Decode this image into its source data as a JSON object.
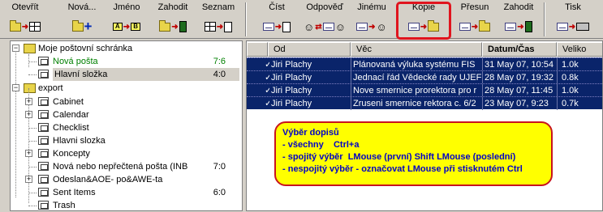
{
  "toolbar": {
    "buttons": [
      {
        "label": "Otevřít",
        "icon": "open-icon"
      },
      {
        "label": "Nová...",
        "icon": "new-folder-icon"
      },
      {
        "label": "Jméno",
        "icon": "rename-icon"
      },
      {
        "label": "Zahodit",
        "icon": "trash-icon"
      },
      {
        "label": "Seznam",
        "icon": "list-icon"
      },
      {
        "label": "Číst",
        "icon": "read-icon"
      },
      {
        "label": "Odpověď",
        "icon": "reply-icon"
      },
      {
        "label": "Jinému",
        "icon": "forward-icon"
      },
      {
        "label": "Kopie",
        "icon": "copy-icon"
      },
      {
        "label": "Přesun",
        "icon": "move-icon"
      },
      {
        "label": "Zahodit",
        "icon": "trash-icon"
      },
      {
        "label": "Tisk",
        "icon": "print-icon"
      }
    ],
    "highlight_color": "#e0141e"
  },
  "tree": {
    "root_label": "Moje poštovní schránka",
    "root_items": [
      {
        "label": "Nová pošta",
        "count": "7:6",
        "color": "#008000"
      },
      {
        "label": "Hlavní složka",
        "count": "4:0",
        "selected": true
      }
    ],
    "export_label": "export",
    "export_items": [
      {
        "label": "Cabinet",
        "count": ""
      },
      {
        "label": "Calendar",
        "count": ""
      },
      {
        "label": "Checklist",
        "count": ""
      },
      {
        "label": "Hlavni slozka",
        "count": ""
      },
      {
        "label": "Koncepty",
        "count": ""
      },
      {
        "label": "Nová nebo nepřečtená pošta (INB",
        "count": "7:0"
      },
      {
        "label": "Odeslan&AOE- po&AWE-ta",
        "count": ""
      },
      {
        "label": "Sent Items",
        "count": "6:0"
      },
      {
        "label": "Trash",
        "count": ""
      }
    ]
  },
  "messages": {
    "columns": [
      "Od",
      "Věc",
      "Datum/Čas",
      "Veliko"
    ],
    "rows": [
      {
        "from": "Jiri Plachy",
        "subject": "Plánovaná výluka systému FIS",
        "date": "31 May 07, 10:54",
        "size": "1.0k"
      },
      {
        "from": "Jiri Plachy",
        "subject": "Jednací řád Vědecké rady UJEF",
        "date": "28 May 07, 19:32",
        "size": "0.8k"
      },
      {
        "from": "Jiri Plachy",
        "subject": "Nove smernice prorektora pro r",
        "date": "28 May 07, 11:45",
        "size": "1.0k"
      },
      {
        "from": "Jiri Plachy",
        "subject": "Zruseni smernice rektora c. 6/2",
        "date": "23 May 07,  9:23",
        "size": "0.7k"
      }
    ],
    "selected_color": "#0a246a"
  },
  "note": {
    "title": "Výběr dopisů",
    "lines": [
      "- všechny    Ctrl+a",
      "- spojitý výběr  LMouse (první) Shift LMouse (poslední)",
      "- nespojitý výběr - označovat LMouse při stisknutém Ctrl"
    ],
    "bg_color": "#ffff00",
    "border_color": "#c8141e",
    "text_color": "#0000c8"
  }
}
